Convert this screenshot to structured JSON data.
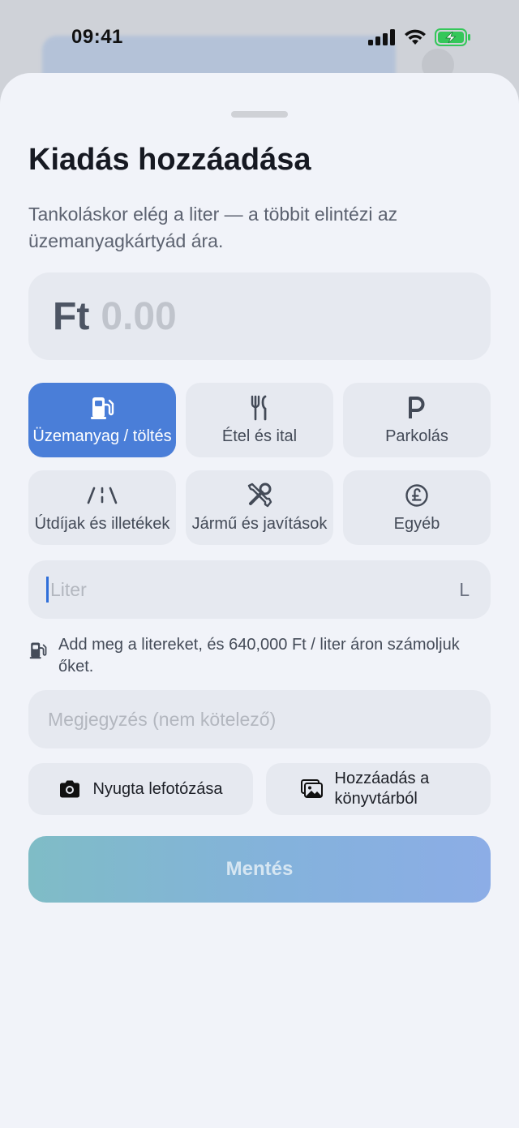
{
  "status_bar": {
    "time": "09:41"
  },
  "sheet": {
    "title": "Kiadás hozzáadása",
    "subtitle": "Tankoláskor elég a liter — a többit elintézi az üzemanyagkártyád ára."
  },
  "amount": {
    "currency": "Ft",
    "value": "0.00"
  },
  "categories": [
    {
      "label": "Üzemanyag / töltés",
      "icon": "fuel-pump-icon",
      "selected": true
    },
    {
      "label": "Étel és ital",
      "icon": "fork-knife-icon",
      "selected": false
    },
    {
      "label": "Parkolás",
      "icon": "parking-icon",
      "selected": false
    },
    {
      "label": "Útdíjak és illetékek",
      "icon": "road-icon",
      "selected": false
    },
    {
      "label": "Jármű és javítások",
      "icon": "tools-icon",
      "selected": false
    },
    {
      "label": "Egyéb",
      "icon": "pound-circle-icon",
      "selected": false
    }
  ],
  "liter_field": {
    "placeholder": "Liter",
    "unit": "L"
  },
  "hint": {
    "text": "Add meg a litereket, és 640,000 Ft / liter áron számoljuk őket."
  },
  "note_field": {
    "placeholder": "Megjegyzés (nem kötelező)"
  },
  "attachments": {
    "photo_label": "Nyugta lefotózása",
    "library_label": "Hozzáadás a könyvtárból"
  },
  "save_button": {
    "label": "Mentés",
    "enabled": false
  },
  "colors": {
    "accent": "#4a7ed8",
    "sheet_background": "#f1f3f9",
    "field_background": "#e6e9f0",
    "battery": "#34c759"
  }
}
